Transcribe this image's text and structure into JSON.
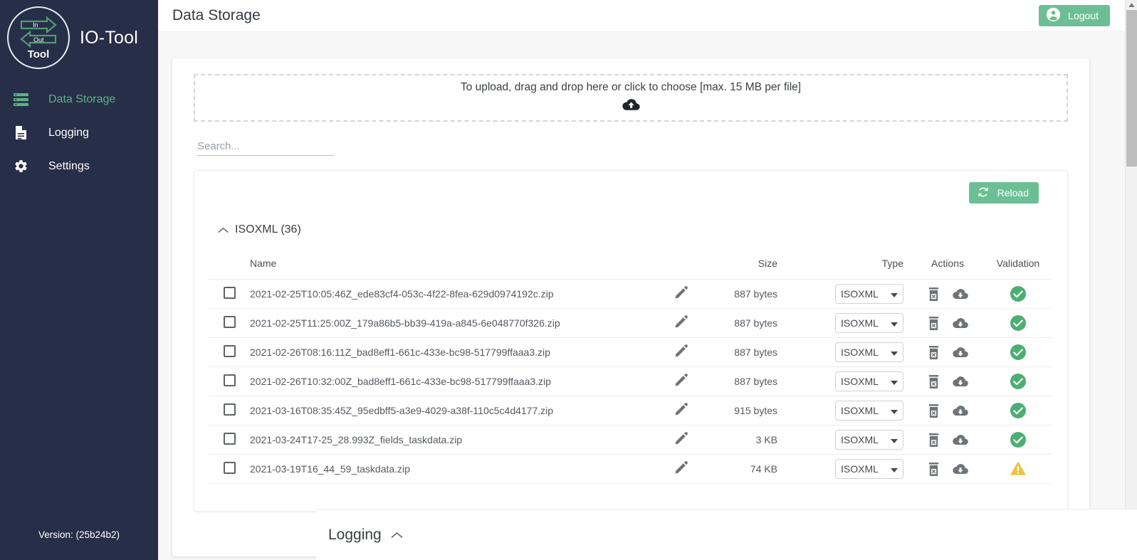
{
  "colors": {
    "sidebar_bg": "#272e48",
    "accent_green": "#6cbf94",
    "active_nav": "#5cb384",
    "page_bg": "#f7f7f7",
    "validation_ok": "#4caf72",
    "validation_warn": "#eec23c"
  },
  "sidebar": {
    "brand_name": "IO-Tool",
    "logo": {
      "in_label": "In",
      "out_label": "Out",
      "tool_label": "Tool"
    },
    "items": [
      {
        "label": "Data Storage",
        "icon": "storage-icon",
        "active": true
      },
      {
        "label": "Logging",
        "icon": "document-icon",
        "active": false
      },
      {
        "label": "Settings",
        "icon": "gear-icon",
        "active": false
      }
    ],
    "version": "Version: (25b24b2)"
  },
  "topbar": {
    "title": "Data Storage",
    "logout_label": "Logout"
  },
  "upload": {
    "text": "To upload, drag and drop here or click to choose [max. 15 MB per file]",
    "icon": "cloud-upload-icon"
  },
  "search": {
    "placeholder": "Search...",
    "value": ""
  },
  "toolbar": {
    "reload_label": "Reload",
    "reload_icon": "refresh-icon"
  },
  "group": {
    "label": "ISOXML (36)",
    "collapse_icon": "chevron-up-icon",
    "expanded": true
  },
  "table": {
    "columns": [
      "",
      "Name",
      "",
      "Size",
      "Type",
      "Actions",
      "Validation"
    ],
    "headers": {
      "name": "Name",
      "size": "Size",
      "type": "Type",
      "actions": "Actions",
      "validation": "Validation"
    },
    "rows": [
      {
        "name": "2021-02-25T10:05:46Z_ede83cf4-053c-4f22-8fea-629d0974192c.zip",
        "size": "887 bytes",
        "type": "ISOXML",
        "validation": "ok"
      },
      {
        "name": "2021-02-25T11:25:00Z_179a86b5-bb39-419a-a845-6e048770f326.zip",
        "size": "887 bytes",
        "type": "ISOXML",
        "validation": "ok"
      },
      {
        "name": "2021-02-26T08:16:11Z_bad8eff1-661c-433e-bc98-517799ffaaa3.zip",
        "size": "887 bytes",
        "type": "ISOXML",
        "validation": "ok"
      },
      {
        "name": "2021-02-26T10:32:00Z_bad8eff1-661c-433e-bc98-517799ffaaa3.zip",
        "size": "887 bytes",
        "type": "ISOXML",
        "validation": "ok"
      },
      {
        "name": "2021-03-16T08:35:45Z_95edbff5-a3e9-4029-a38f-110c5c4d4177.zip",
        "size": "915 bytes",
        "type": "ISOXML",
        "validation": "ok"
      },
      {
        "name": "2021-03-24T17-25_28.993Z_fields_taskdata.zip",
        "size": "3 KB",
        "type": "ISOXML",
        "validation": "ok"
      },
      {
        "name": "2021-03-19T16_44_59_taskdata.zip",
        "size": "74 KB",
        "type": "ISOXML",
        "validation": "warn"
      }
    ]
  },
  "bottom": {
    "logging_label": "Logging",
    "collapse_icon": "chevron-up-icon"
  }
}
